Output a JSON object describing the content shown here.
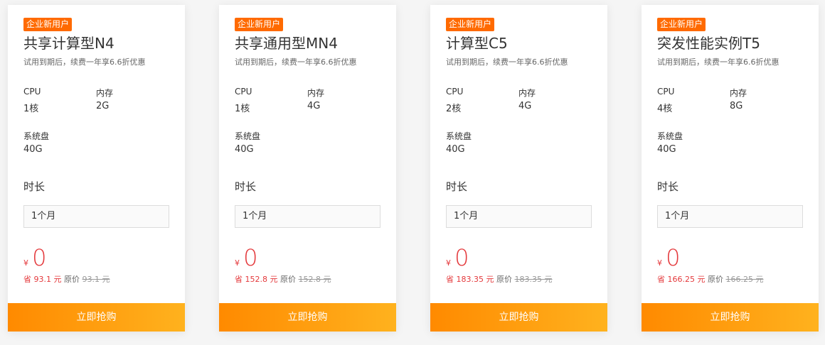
{
  "colors": {
    "badge": "#ff6a00",
    "price": "#e4393c",
    "button_start": "#ff8a00",
    "button_end": "#ffb21e"
  },
  "labels": {
    "cpu": "CPU",
    "memory": "内存",
    "disk": "系统盘",
    "duration": "时长",
    "save": "省",
    "original": "原价",
    "buy": "立即抢购",
    "currency": "¥"
  },
  "cards": [
    {
      "badge": "企业新用户",
      "title": "共享计算型N4",
      "subtitle": "试用到期后，续费一年享6.6折优惠",
      "cpu": "1核",
      "memory": "2G",
      "disk": "40G",
      "duration_value": "1个月",
      "price": "0",
      "save_amount": "93.1 元",
      "original_price": "93.1 元"
    },
    {
      "badge": "企业新用户",
      "title": "共享通用型MN4",
      "subtitle": "试用到期后，续费一年享6.6折优惠",
      "cpu": "1核",
      "memory": "4G",
      "disk": "40G",
      "duration_value": "1个月",
      "price": "0",
      "save_amount": "152.8 元",
      "original_price": "152.8 元"
    },
    {
      "badge": "企业新用户",
      "title": "计算型C5",
      "subtitle": "试用到期后，续费一年享6.6折优惠",
      "cpu": "2核",
      "memory": "4G",
      "disk": "40G",
      "duration_value": "1个月",
      "price": "0",
      "save_amount": "183.35 元",
      "original_price": "183.35 元"
    },
    {
      "badge": "企业新用户",
      "title": "突发性能实例T5",
      "subtitle": "试用到期后，续费一年享6.6折优惠",
      "cpu": "4核",
      "memory": "8G",
      "disk": "40G",
      "duration_value": "1个月",
      "price": "0",
      "save_amount": "166.25 元",
      "original_price": "166.25 元"
    }
  ]
}
